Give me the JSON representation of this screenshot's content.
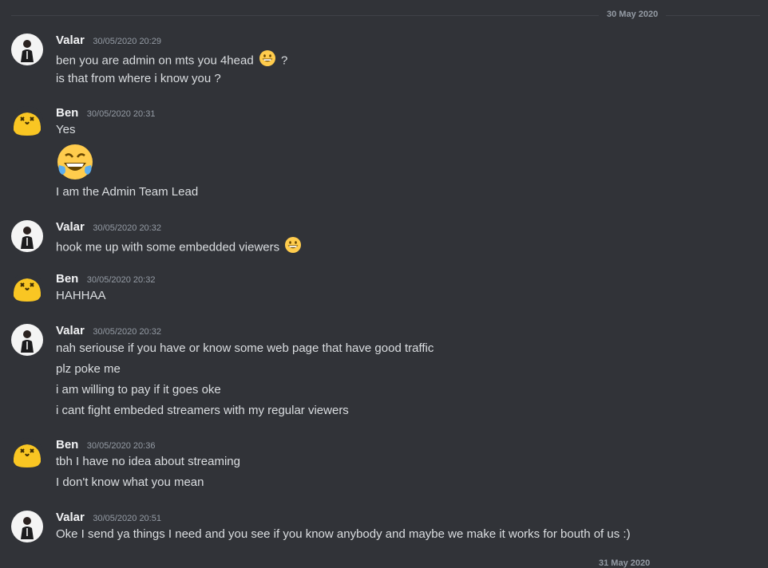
{
  "date_dividers": [
    "30 May 2020",
    "31 May 2020"
  ],
  "messages": [
    {
      "author": "Valar",
      "timestamp": "30/05/2020 20:29",
      "lines": [
        "ben you are admin on mts you 4head",
        "?",
        "is that from where i know you ?"
      ]
    },
    {
      "author": "Ben",
      "timestamp": "30/05/2020 20:31",
      "lines": [
        "Yes",
        "I am the Admin Team Lead"
      ]
    },
    {
      "author": "Valar",
      "timestamp": "30/05/2020 20:32",
      "lines": [
        "hook me up with some embedded viewers"
      ]
    },
    {
      "author": "Ben",
      "timestamp": "30/05/2020 20:32",
      "lines": [
        "HAHHAA"
      ]
    },
    {
      "author": "Valar",
      "timestamp": "30/05/2020 20:32",
      "lines": [
        "nah seriouse if you have or know some web page that have good traffic",
        "plz poke me",
        "i am willing to pay if it goes oke",
        "i cant fight embeded streamers with my regular viewers"
      ]
    },
    {
      "author": "Ben",
      "timestamp": "30/05/2020 20:36",
      "lines": [
        "tbh I have no idea about streaming",
        "I don't know what you mean"
      ]
    },
    {
      "author": "Valar",
      "timestamp": "30/05/2020 20:51",
      "lines": [
        "Oke I send ya things I need and you see if you know anybody and maybe we make it works for bouth of us :)"
      ]
    }
  ],
  "emojis": {
    "grin": "grinning-face-icon",
    "tears_of_joy": "face-with-tears-of-joy-icon"
  },
  "colors": {
    "background": "#313338",
    "username": "#f2f3f5",
    "text": "#dbdee1",
    "muted": "#949ba4",
    "ben_avatar": "#f9c623"
  }
}
